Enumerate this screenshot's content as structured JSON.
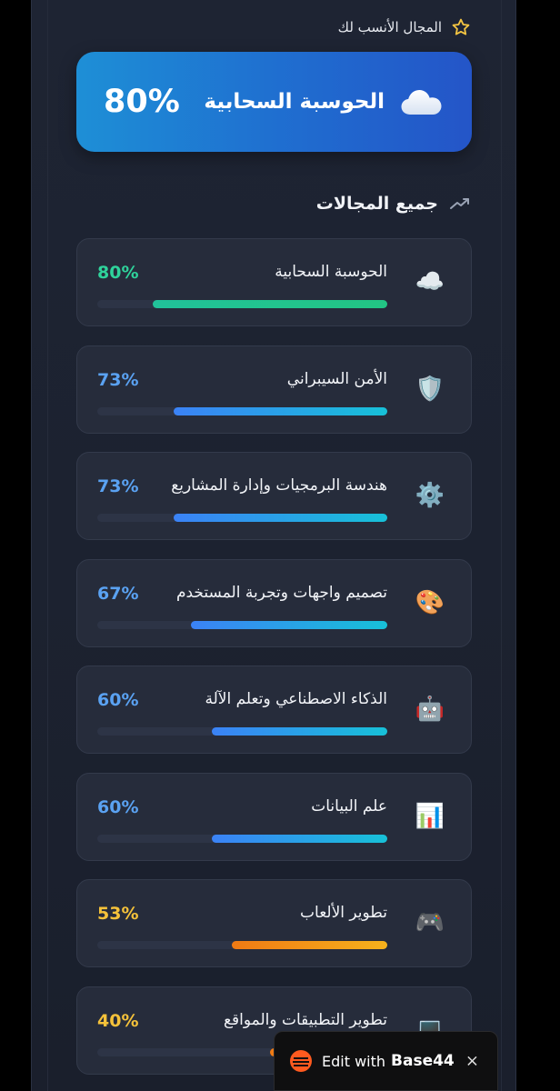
{
  "best_fit": {
    "label": "المجال الأنسب لك",
    "star_icon": "star-icon",
    "name": "الحوسبة السحابية",
    "percent": "80%",
    "icon": "cloud-icon"
  },
  "section": {
    "title": "جميع المجالات",
    "icon": "trend-icon"
  },
  "fields": [
    {
      "name": "الحوسبة السحابية",
      "percent": "80%",
      "value": 80,
      "icon": "cloud-icon",
      "glyph": "☁️",
      "pct_color": "#2fd39b",
      "bar_from": "#21c29a",
      "bar_to": "#22c583"
    },
    {
      "name": "الأمن السيبراني",
      "percent": "73%",
      "value": 73,
      "icon": "shield-icon",
      "glyph": "🛡️",
      "pct_color": "#5aa2f2",
      "bar_from": "#3b82f6",
      "bar_to": "#17c1d8"
    },
    {
      "name": "هندسة البرمجيات وإدارة المشاريع",
      "percent": "73%",
      "value": 73,
      "icon": "gear-icon",
      "glyph": "⚙️",
      "pct_color": "#5aa2f2",
      "bar_from": "#3b82f6",
      "bar_to": "#17c1d8"
    },
    {
      "name": "تصميم واجهات وتجربة المستخدم",
      "percent": "67%",
      "value": 67,
      "icon": "palette-icon",
      "glyph": "🎨",
      "pct_color": "#5aa2f2",
      "bar_from": "#3b82f6",
      "bar_to": "#17c1d8"
    },
    {
      "name": "الذكاء الاصطناعي وتعلم الآلة",
      "percent": "60%",
      "value": 60,
      "icon": "robot-icon",
      "glyph": "🤖",
      "pct_color": "#5aa2f2",
      "bar_from": "#3b82f6",
      "bar_to": "#17c1d8"
    },
    {
      "name": "علم البيانات",
      "percent": "60%",
      "value": 60,
      "icon": "bar-chart-icon",
      "glyph": "📊",
      "pct_color": "#5aa2f2",
      "bar_from": "#3b82f6",
      "bar_to": "#17c1d8"
    },
    {
      "name": "تطوير الألعاب",
      "percent": "53%",
      "value": 53,
      "icon": "gamepad-icon",
      "glyph": "🎮",
      "pct_color": "#f5c23a",
      "bar_from": "#f07a14",
      "bar_to": "#f6b21c"
    },
    {
      "name": "تطوير التطبيقات والمواقع",
      "percent": "40%",
      "value": 40,
      "icon": "laptop-icon",
      "glyph": "💻",
      "pct_color": "#f5c23a",
      "bar_from": "#f07a14",
      "bar_to": "#f6b21c"
    }
  ],
  "badge": {
    "edit_label": "Edit with",
    "brand": "Base44",
    "close": "×",
    "logo_icon": "base44-logo-icon",
    "brand_color": "#ff5a1f"
  }
}
